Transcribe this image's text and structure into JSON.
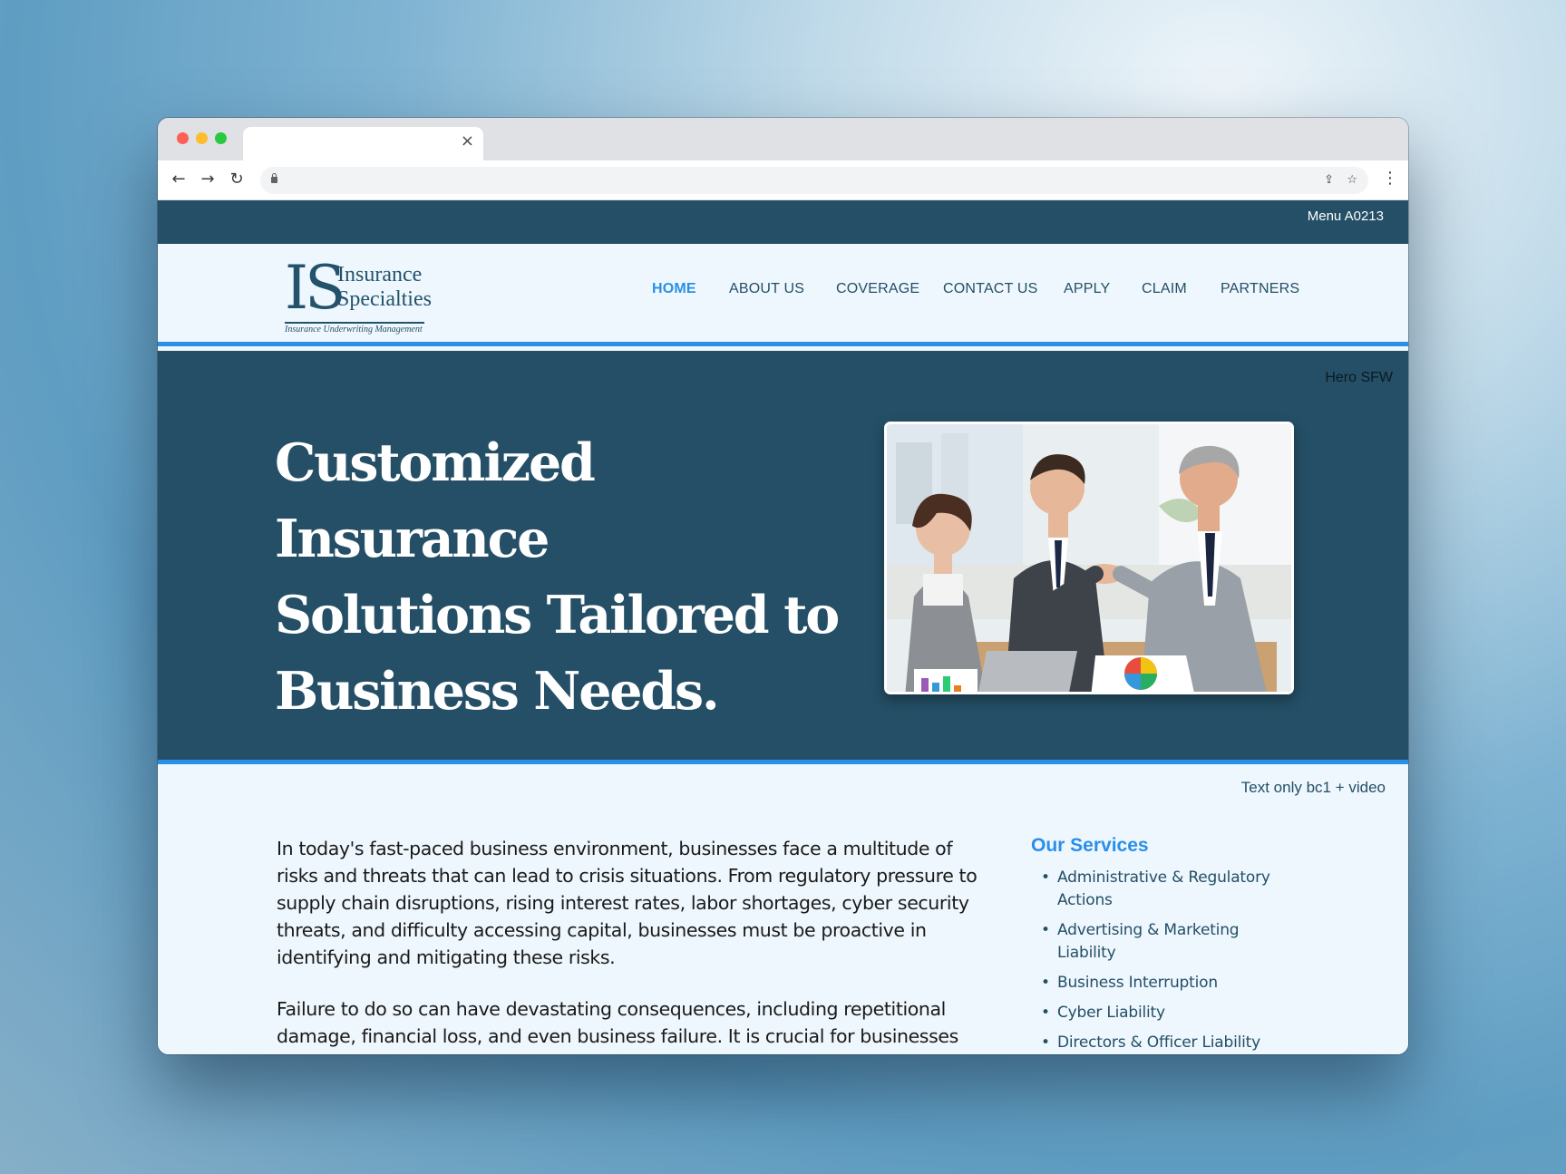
{
  "browser": {
    "tab_close": "×",
    "back_icon": "←",
    "forward_icon": "→",
    "reload_icon": "↻",
    "share_icon": "⇪",
    "bookmark_icon": "☆",
    "menu_icon": "⋮"
  },
  "topbar": {
    "label": "Menu A0213"
  },
  "logo": {
    "mark": "IS",
    "line1": "Insurance",
    "line2": "Specialties",
    "tagline": "Insurance Underwriting Management"
  },
  "nav": {
    "items": [
      {
        "label": "HOME",
        "active": true
      },
      {
        "label": "ABOUT US"
      },
      {
        "label": "COVERAGE"
      },
      {
        "label": "CONTACT US"
      },
      {
        "label": "APPLY"
      },
      {
        "label": "CLAIM"
      },
      {
        "label": "PARTNERS"
      }
    ]
  },
  "hero": {
    "label": "Hero SFW",
    "title_line1": "Customized Insurance",
    "title_line2": "Solutions Tailored to",
    "title_line3": "Business Needs."
  },
  "content": {
    "label": "Text only bc1 + video",
    "paragraph1": "In today's fast-paced business environment, businesses face a multitude of risks and threats that can lead to crisis situations. From regulatory pressure to supply chain disruptions, rising interest rates, labor shortages, cyber security threats, and difficulty accessing capital, businesses must be proactive in identifying and mitigating these risks.",
    "paragraph2": "Failure to do so can have devastating consequences, including repetitional damage, financial loss, and even business failure. It is crucial for businesses to",
    "services_title": "Our Services",
    "services": [
      "Administrative & Regulatory Actions",
      "Advertising & Marketing Liability",
      "Business Interruption",
      "Cyber Liability",
      "Directors & Officer Liability"
    ]
  },
  "colors": {
    "brand_dark": "#244f66",
    "accent": "#2a8fe8",
    "page_bg": "#eef7fd"
  }
}
